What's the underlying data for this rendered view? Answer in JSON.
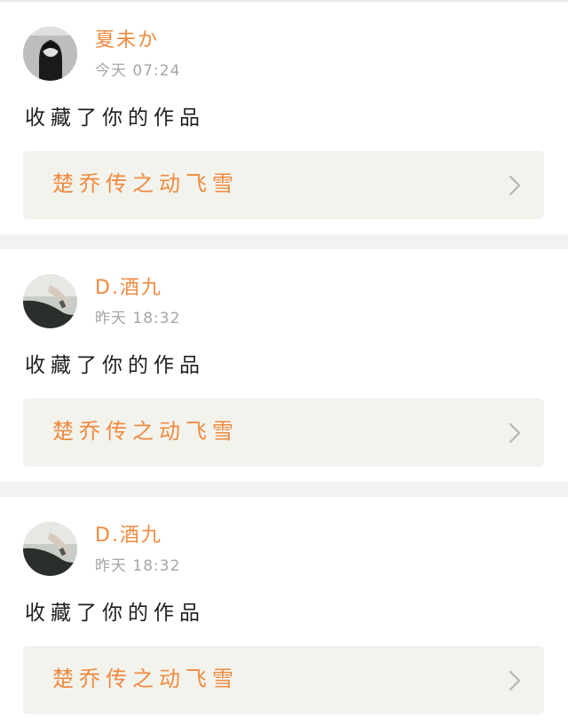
{
  "feed": {
    "items": [
      {
        "user": {
          "name": "夏未か",
          "avatar_icon": "avatar-dark-portrait-icon"
        },
        "time": "今天 07:24",
        "action": "收藏了你的作品",
        "work": {
          "title": "楚乔传之动飞雪"
        }
      },
      {
        "user": {
          "name": "D.酒九",
          "avatar_icon": "avatar-arm-photo-icon"
        },
        "time": "昨天 18:32",
        "action": "收藏了你的作品",
        "work": {
          "title": "楚乔传之动飞雪"
        }
      },
      {
        "user": {
          "name": "D.酒九",
          "avatar_icon": "avatar-arm-photo-icon"
        },
        "time": "昨天 18:32",
        "action": "收藏了你的作品",
        "work": {
          "title": "楚乔传之动飞雪"
        }
      }
    ]
  },
  "colors": {
    "accent": "#f08a3f",
    "card_background": "#ffffff",
    "page_background": "#f2f2f2",
    "work_link_background": "#f3f3ed",
    "timestamp": "#a6a6a6",
    "text": "#1f1f1f"
  },
  "icons": {
    "chevron": "chevron-right-icon"
  }
}
